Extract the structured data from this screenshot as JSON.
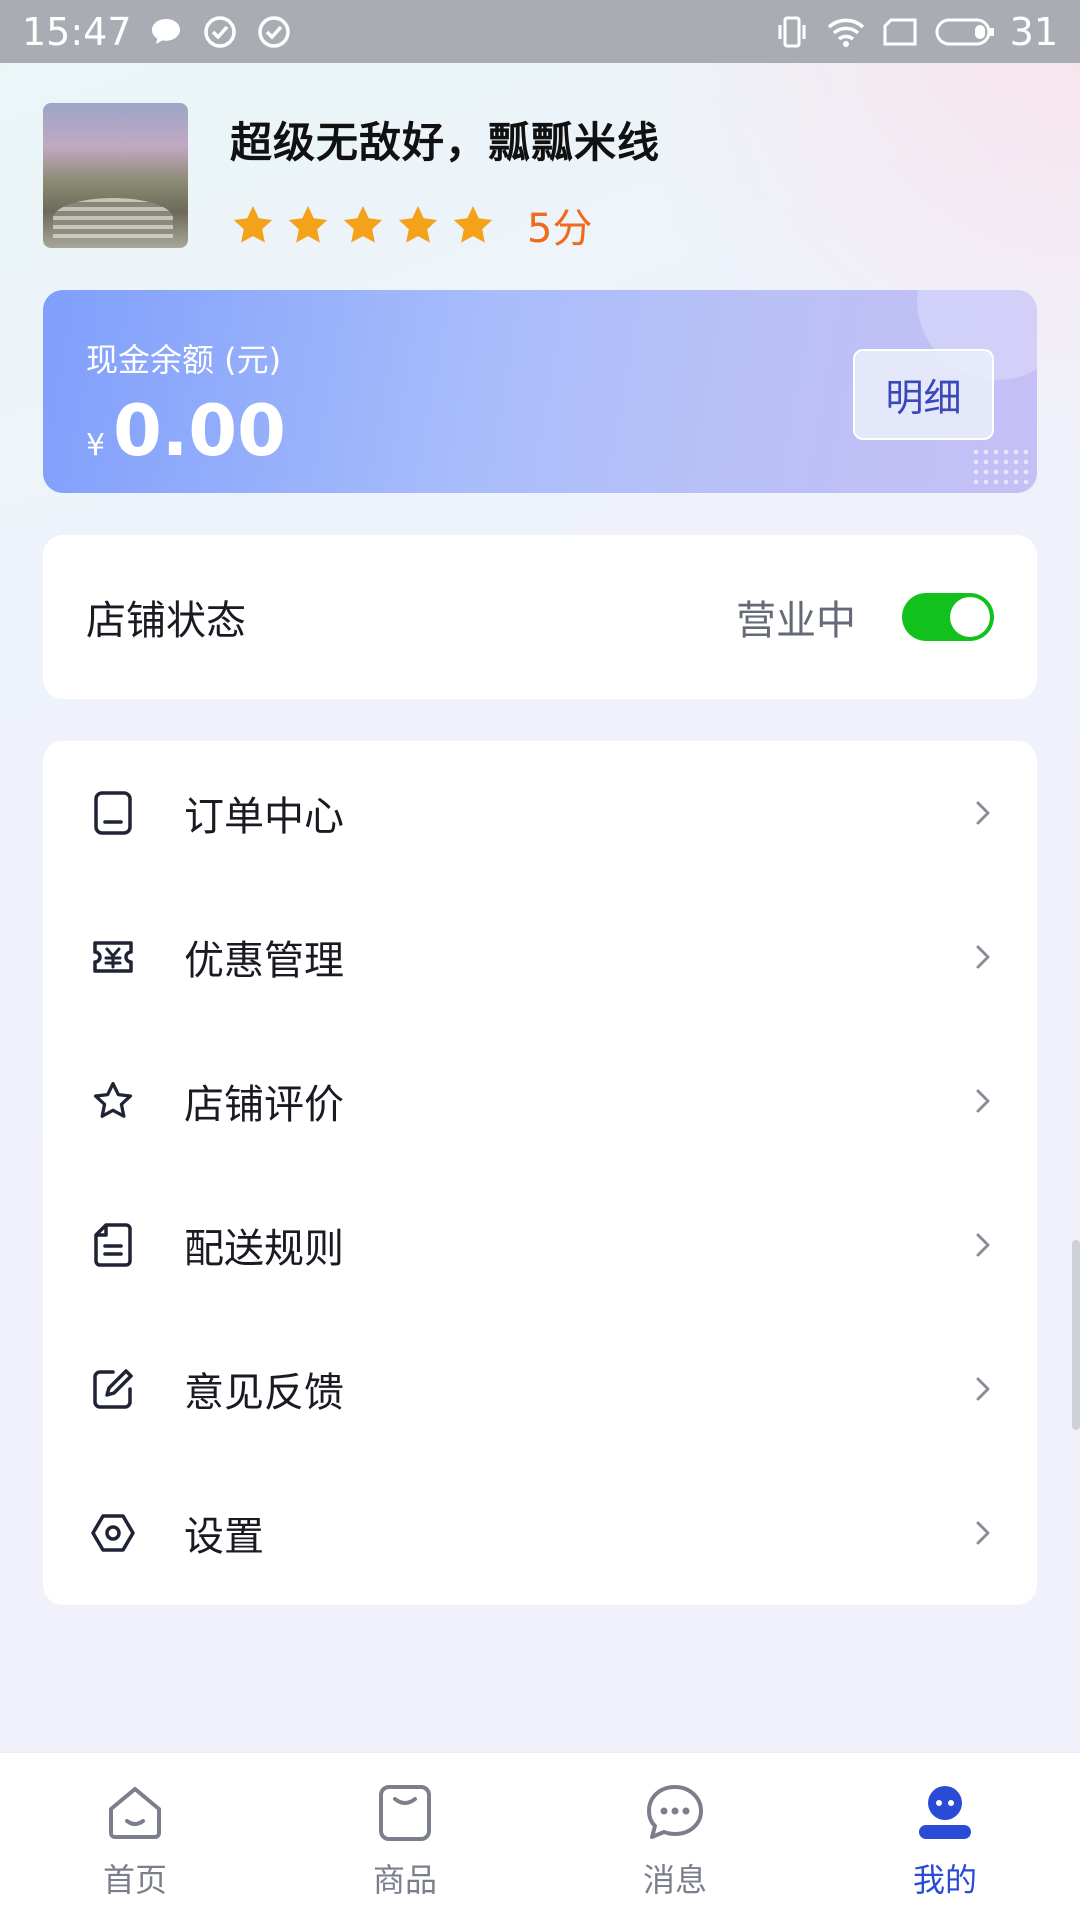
{
  "status_bar": {
    "time": "15:47",
    "battery": "31",
    "icons_left": [
      "chat-bubble-icon",
      "check-circle-icon",
      "check-circle-icon"
    ],
    "icons_right": [
      "vibrate-icon",
      "wifi-icon",
      "sim-icon",
      "battery-icon"
    ]
  },
  "shop": {
    "name": "超级无敌好，瓢瓢米线",
    "rating_stars": 5,
    "score_text": "5分",
    "star_color": "#f5a21b"
  },
  "balance": {
    "label": "现金余额 (元)",
    "currency": "¥",
    "amount": "0.00",
    "detail_button": "明细"
  },
  "store_status": {
    "label": "店铺状态",
    "value": "营业中",
    "toggle_on": true,
    "toggle_color": "#12c21c"
  },
  "menu": {
    "items": [
      {
        "label": "订单中心",
        "icon": "order-icon"
      },
      {
        "label": "优惠管理",
        "icon": "coupon-icon"
      },
      {
        "label": "店铺评价",
        "icon": "star-outline-icon"
      },
      {
        "label": "配送规则",
        "icon": "document-icon"
      },
      {
        "label": "意见反馈",
        "icon": "edit-icon"
      },
      {
        "label": "设置",
        "icon": "settings-icon"
      }
    ]
  },
  "nav": {
    "items": [
      {
        "label": "首页",
        "icon": "home-icon",
        "active": false
      },
      {
        "label": "商品",
        "icon": "bag-icon",
        "active": false
      },
      {
        "label": "消息",
        "icon": "message-icon",
        "active": false
      },
      {
        "label": "我的",
        "icon": "profile-icon",
        "active": true
      }
    ],
    "active_color": "#2a4bd6"
  }
}
